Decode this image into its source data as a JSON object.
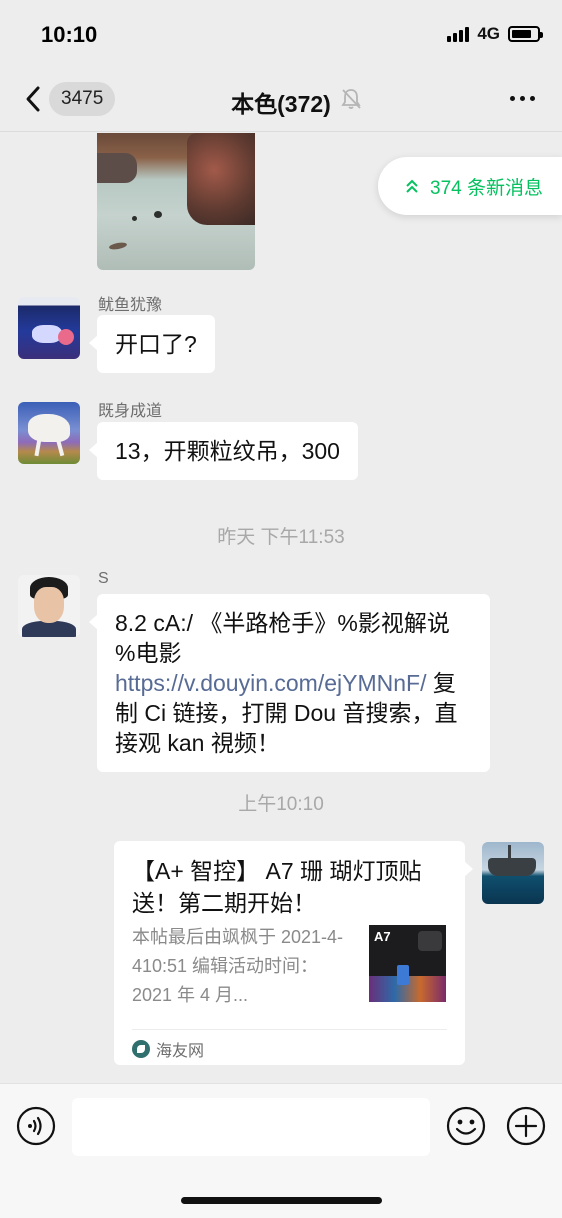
{
  "status_bar": {
    "time": "10:10",
    "network": "4G",
    "battery_level": 0.8
  },
  "nav": {
    "unread_count": "3475",
    "title": "本色(372)"
  },
  "new_messages": {
    "label": "374 条新消息"
  },
  "messages": [
    {
      "sender": "鱿鱼犹豫",
      "text": "开口了?"
    },
    {
      "sender": "既身成道",
      "text": "13，开颗粒纹吊，300"
    },
    {
      "sender": "S",
      "text_before_link": "8.2 cA:/ 《半路枪手》%影视解说 %电影 ",
      "link": "https://v.douyin.com/ejYMNnF/",
      "text_after_link": " 复制 Ci 链接，打開 Dou 音搜索，直接观 kan 視频！"
    }
  ],
  "timestamps": {
    "first": "昨天 下午11:53",
    "second": "上午10:10"
  },
  "link_card": {
    "title": "【A+ 智控】 A7 珊 瑚灯顶贴送！第二期开始！",
    "description": "本帖最后由飒枫于 2021-4-410:51 编辑活动时间：2021 年 4 月...",
    "thumb_label": "A7",
    "source": "海友网"
  },
  "input": {
    "placeholder": ""
  }
}
